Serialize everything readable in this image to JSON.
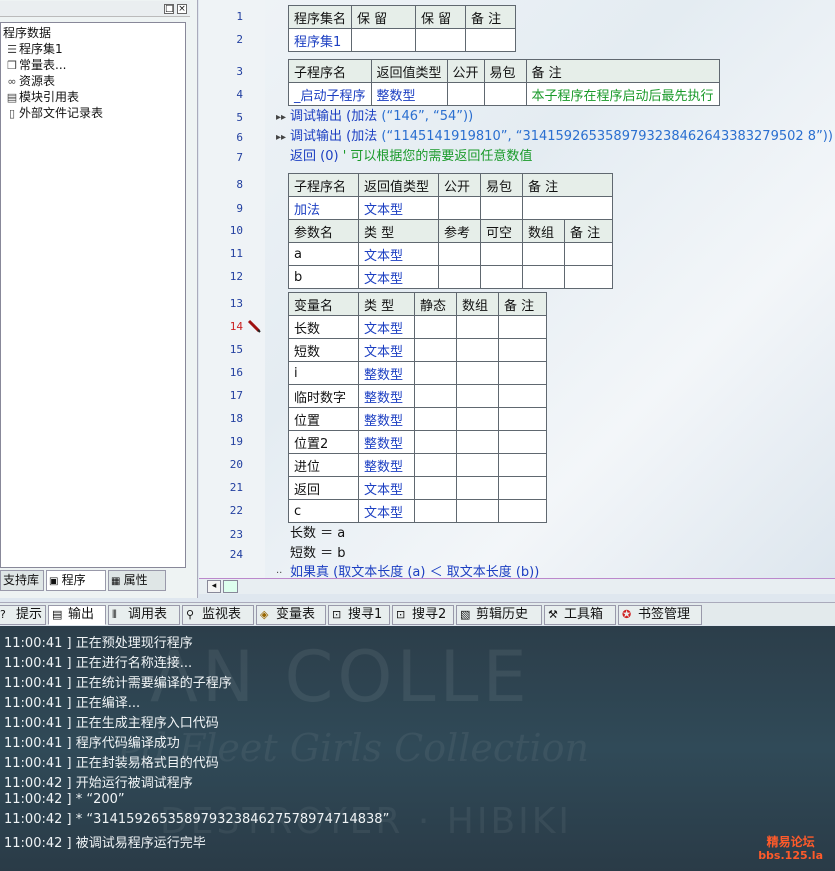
{
  "left_panel": {
    "tree": [
      {
        "label": "程序数据",
        "icon": "folder-icon",
        "indent": 0
      },
      {
        "label": "程序集1",
        "icon": "stack-icon",
        "indent": 1
      },
      {
        "label": "常量表...",
        "icon": "cubes-icon",
        "indent": 1
      },
      {
        "label": "资源表",
        "icon": "resource-icon",
        "indent": 1
      },
      {
        "label": "模块引用表",
        "icon": "module-icon",
        "indent": 1
      },
      {
        "label": "外部文件记录表",
        "icon": "file-icon",
        "indent": 1
      }
    ],
    "tabs": [
      "支持库",
      "程序",
      "属性"
    ],
    "title_buttons": [
      "□",
      "×"
    ]
  },
  "editor": {
    "line_numbers": [
      "1",
      "2",
      "3",
      "4",
      "5",
      "6",
      "7",
      "8",
      "9",
      "10",
      "11",
      "12",
      "13",
      "14",
      "15",
      "16",
      "17",
      "18",
      "19",
      "20",
      "21",
      "22",
      "23",
      "24"
    ],
    "active_line": "14",
    "assembly_table": {
      "headers": [
        "程序集名",
        "保 留",
        "保 留",
        "备 注"
      ],
      "row": [
        "程序集1",
        "",
        "",
        ""
      ]
    },
    "start_sub_table": {
      "headers": [
        "子程序名",
        "返回值类型",
        "公开",
        "易包",
        "备 注"
      ],
      "row": [
        "_启动子程序",
        "整数型",
        "",
        "",
        "本子程序在程序启动后最先执行"
      ]
    },
    "code_lines": [
      {
        "fn": "调试输出",
        "rest_a": " (",
        "fn2": "加法",
        "rest_b": " (“146”, “54”))"
      },
      {
        "fn": "调试输出",
        "rest_a": " (",
        "fn2": "加法",
        "rest_b": " (“1145141919810”, “3141592653589793238462643383279502 8”))"
      }
    ],
    "return_line": {
      "kw": "返回",
      "val": " (0) ",
      "comment": "' 可以根据您的需要返回任意数值"
    },
    "add_sub_table": {
      "headers": [
        "子程序名",
        "返回值类型",
        "公开",
        "易包",
        "备 注"
      ],
      "row": [
        "加法",
        "文本型",
        "",
        "",
        ""
      ],
      "param_headers": [
        "参数名",
        "类 型",
        "参考",
        "可空",
        "数组",
        "备 注"
      ],
      "params": [
        [
          "a",
          "文本型"
        ],
        [
          "b",
          "文本型"
        ]
      ]
    },
    "var_table": {
      "headers": [
        "变量名",
        "类 型",
        "静态",
        "数组",
        "备 注"
      ],
      "rows": [
        [
          "长数",
          "文本型"
        ],
        [
          "短数",
          "文本型"
        ],
        [
          "i",
          "整数型"
        ],
        [
          "临时数字",
          "整数型"
        ],
        [
          "位置",
          "整数型"
        ],
        [
          "位置2",
          "整数型"
        ],
        [
          "进位",
          "整数型"
        ],
        [
          "返回",
          "文本型"
        ],
        [
          "c",
          "文本型"
        ]
      ]
    },
    "assign_lines": [
      "长数 ＝ a",
      "短数 ＝ b"
    ],
    "partial_line": "如果真 (取文本长度 (a) ＜ 取文本长度 (b))"
  },
  "bottom_tabs": [
    "提示",
    "输出",
    "调用表",
    "监视表",
    "变量表",
    "搜寻1",
    "搜寻2",
    "剪辑历史",
    "工具箱",
    "书签管理"
  ],
  "active_bottom_tab": "输出",
  "output_lines": [
    "11:00:41 ]  正在预处理现行程序",
    "11:00:41 ]  正在进行名称连接...",
    "11:00:41 ]  正在统计需要编译的子程序",
    "11:00:41 ]  正在编译...",
    "11:00:41 ]  正在生成主程序入口代码",
    "11:00:41 ]  程序代码编译成功",
    "11:00:41 ]  正在封装易格式目的代码",
    "11:00:42 ]  开始运行被调试程序",
    "11:00:42 ]  *  “200”",
    "11:00:42 ]  *  “31415926535897932384627578974714838”",
    "11:00:42 ]  被调试易程序运行完毕"
  ],
  "watermark": {
    "line1": "AN COLLE",
    "line2": "ed Fleet Girls Collection",
    "line3": "DESTROYER · HIBIKI"
  },
  "forum_badge": {
    "line1": "精易论坛",
    "line2": "bbs.125.la"
  },
  "colors": {
    "keyword_blue": "#1c3fc2",
    "comment_green": "#1a9a2a",
    "output_bg": "#2f4350",
    "line_number": "#2340a0"
  }
}
